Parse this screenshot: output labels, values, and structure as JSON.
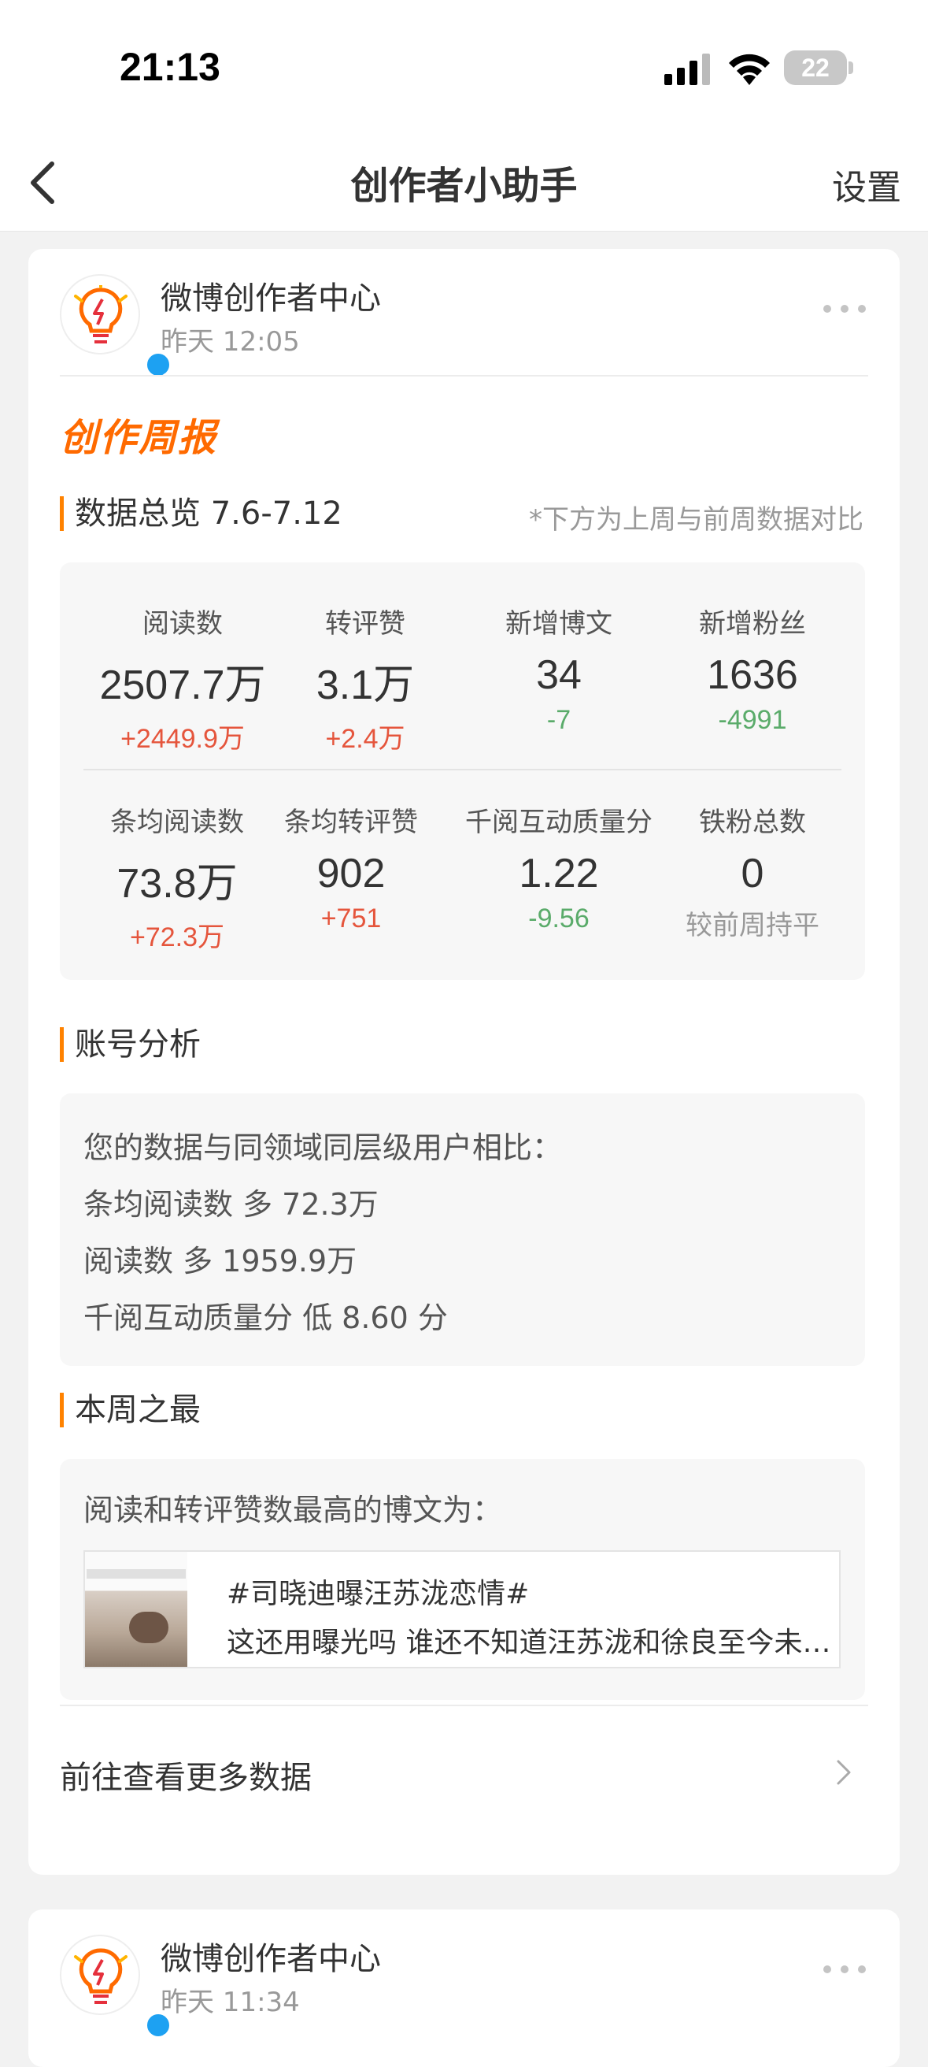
{
  "status_bar": {
    "time": "21:13",
    "battery": "22"
  },
  "nav": {
    "title": "创作者小助手",
    "settings_label": "设置"
  },
  "colors": {
    "accent": "#ff8200",
    "increase": "#e5553c",
    "decrease": "#5aab6a"
  },
  "posts": [
    {
      "author": "微博创作者中心",
      "time": "昨天 12:05",
      "weekly_title": "创作周报",
      "overview": {
        "heading": "数据总览 7.6-7.12",
        "note": "*下方为上周与前周数据对比",
        "stats": [
          {
            "label": "阅读数",
            "value": "2507.7万",
            "delta": "+2449.9万",
            "trend": "up"
          },
          {
            "label": "转评赞",
            "value": "3.1万",
            "delta": "+2.4万",
            "trend": "up"
          },
          {
            "label": "新增博文",
            "value": "34",
            "delta": "-7",
            "trend": "down"
          },
          {
            "label": "新增粉丝",
            "value": "1636",
            "delta": "-4991",
            "trend": "down"
          },
          {
            "label": "条均阅读数",
            "value": "73.8万",
            "delta": "+72.3万",
            "trend": "up"
          },
          {
            "label": "条均转评赞",
            "value": "902",
            "delta": "+751",
            "trend": "up"
          },
          {
            "label": "千阅互动质量分",
            "value": "1.22",
            "delta": "-9.56",
            "trend": "down"
          },
          {
            "label": "铁粉总数",
            "value": "0",
            "delta": "较前周持平",
            "trend": "flat"
          }
        ]
      },
      "analysis": {
        "heading": "账号分析",
        "lines": [
          "您的数据与同领域同层级用户相比：",
          "条均阅读数 多 72.3万",
          "阅读数 多 1959.9万",
          "千阅互动质量分 低 8.60 分"
        ]
      },
      "best": {
        "heading": "本周之最",
        "intro": "阅读和转评赞数最高的博文为：",
        "tag": "#司晓迪曝汪苏泷恋情#",
        "snippet": "这还用曝光吗 谁还不知道汪苏泷和徐良至今未…"
      },
      "more_link": "前往查看更多数据"
    },
    {
      "author": "微博创作者中心",
      "time": "昨天 11:34"
    }
  ]
}
